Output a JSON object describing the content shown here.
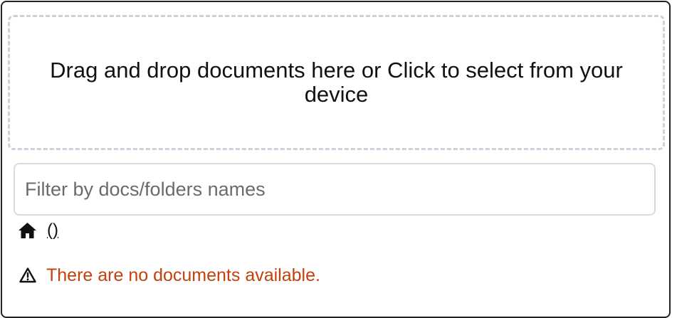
{
  "upload": {
    "dropzone_text": "Drag and drop documents here or Click to select from your device"
  },
  "filter": {
    "placeholder": "Filter by docs/folders names",
    "value": ""
  },
  "breadcrumb": {
    "home_icon": "home-icon",
    "count_text": "()"
  },
  "notice": {
    "icon": "warning-triangle-icon",
    "text": "There are no documents available.",
    "color": "#c2410c"
  }
}
